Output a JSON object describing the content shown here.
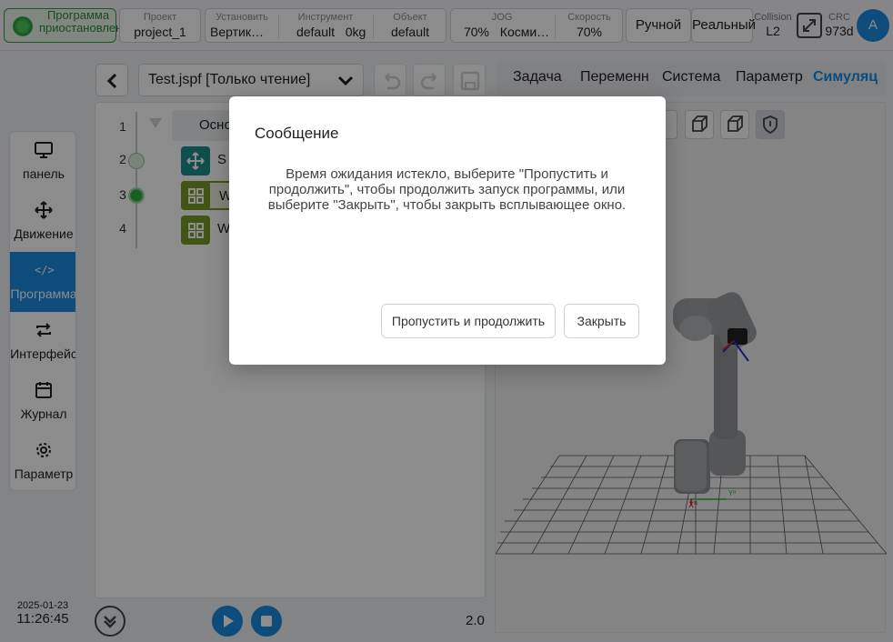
{
  "topbar": {
    "status": "Программа приостановлена",
    "project_label": "Проект",
    "project_value": "project_1",
    "install_label": "Установить",
    "install_value": "Вертик…",
    "tool_label": "Инструмент",
    "tool_value": "default",
    "tool_weight": "0kg",
    "object_label": "Объект",
    "object_value": "default",
    "jog_label": "JOG",
    "jog_value": "70%",
    "jog_mode": "Косми…",
    "speed_label": "Скорость",
    "speed_value": "70%",
    "manual_button": "Ручной",
    "real_button": "Реальный",
    "collision_label": "Collision",
    "collision_value": "L2",
    "crc_label": "CRC",
    "crc_value": "973d",
    "avatar_letter": "A"
  },
  "sidebar": {
    "items": [
      {
        "label": "панель",
        "icon": "monitor-icon"
      },
      {
        "label": "Движение",
        "icon": "move-icon"
      },
      {
        "label": "Программа",
        "icon": "code-icon"
      },
      {
        "label": "Интерфейс",
        "icon": "swap-icon"
      },
      {
        "label": "Журнал",
        "icon": "calendar-icon"
      },
      {
        "label": "Параметр",
        "icon": "gear-icon"
      }
    ],
    "active_index": 2
  },
  "datetime": {
    "date": "2025-01-23",
    "time": "11:26:45"
  },
  "editor": {
    "file_name": "Test.jspf [Только чтение]",
    "tabs": [
      "Задача",
      "Переменн",
      "Система",
      "Параметр",
      "Симуляц"
    ],
    "active_tab": "Симуляц"
  },
  "program": {
    "line_numbers": [
      "1",
      "2",
      "3",
      "4"
    ],
    "blocks": [
      {
        "text": "Осно"
      },
      {
        "text": "S"
      },
      {
        "text": "W"
      },
      {
        "text": "W"
      }
    ]
  },
  "playback": {
    "speed": "2.0"
  },
  "dialog": {
    "title": "Сообщение",
    "message": "Время ожидания истекло, выберите \"Пропустить и продолжить\", чтобы продолжить запуск программы, или выберите \"Закрыть\", чтобы закрыть всплывающее окно.",
    "skip_button": "Пропустить и продолжить",
    "close_button": "Закрыть"
  },
  "colors": {
    "accent": "#1a8be0",
    "status_green": "#3a9a4a",
    "block_teal": "#1a8f8a",
    "block_olive": "#7a9a2a"
  }
}
